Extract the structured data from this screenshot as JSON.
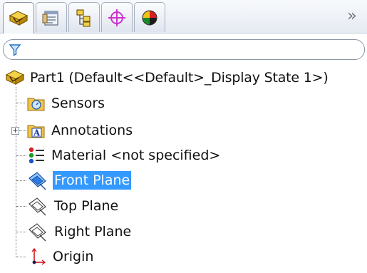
{
  "tabs": [
    {
      "name": "feature-manager",
      "icon": "feature-tree-icon"
    },
    {
      "name": "property-manager",
      "icon": "property-manager-icon"
    },
    {
      "name": "configuration-manager",
      "icon": "configuration-manager-icon"
    },
    {
      "name": "dimxpert-manager",
      "icon": "dimxpert-crosshair-icon"
    },
    {
      "name": "display-manager",
      "icon": "display-manager-icon"
    }
  ],
  "overflow_label": "»",
  "filter": {
    "value": "",
    "placeholder": ""
  },
  "tree": {
    "root": {
      "label": "Part1  (Default<<Default>_Display State 1>)"
    },
    "items": [
      {
        "label": "Sensors",
        "icon": "sensors-folder-icon"
      },
      {
        "label": "Annotations",
        "icon": "annotations-folder-icon",
        "expandable": true
      },
      {
        "label": "Material <not specified>",
        "icon": "material-icon"
      },
      {
        "label": "Front Plane",
        "icon": "plane-icon",
        "selected": true
      },
      {
        "label": "Top Plane",
        "icon": "plane-icon"
      },
      {
        "label": "Right Plane",
        "icon": "plane-icon"
      },
      {
        "label": "Origin",
        "icon": "origin-icon"
      }
    ]
  },
  "colors": {
    "selection": "#3399ff",
    "tab_border": "#a6b0bf",
    "dimxpert_magenta": "#cc33cc"
  }
}
